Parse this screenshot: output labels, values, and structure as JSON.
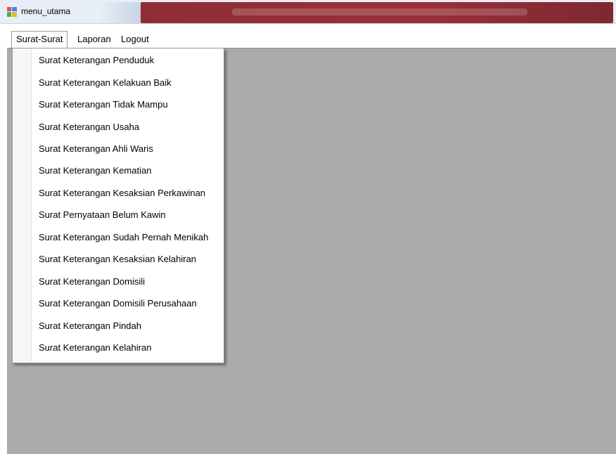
{
  "window": {
    "title": "menu_utama"
  },
  "menubar": {
    "items": [
      "Surat-Surat",
      "Laporan",
      "Logout"
    ]
  },
  "dropdown": {
    "items": [
      "Surat Keterangan Penduduk",
      "Surat Keterangan Kelakuan Baik",
      "Surat Keterangan Tidak Mampu",
      "Surat Keterangan Usaha",
      "Surat Keterangan Ahli Waris",
      "Surat Keterangan Kematian",
      "Surat Keterangan Kesaksian Perkawinan",
      "Surat Pernyataan Belum Kawin",
      "Surat Keterangan Sudah Pernah Menikah",
      "Surat Keterangan Kesaksian Kelahiran",
      "Surat Keterangan Domisili",
      "Surat Keterangan Domisili Perusahaan",
      "Surat Keterangan Pindah",
      "Surat Keterangan Kelahiran"
    ]
  },
  "colors": {
    "client_background": "#ababab",
    "titlebar_accent": "#9a2f38"
  },
  "icons": {
    "app": "windows-form-icon"
  }
}
